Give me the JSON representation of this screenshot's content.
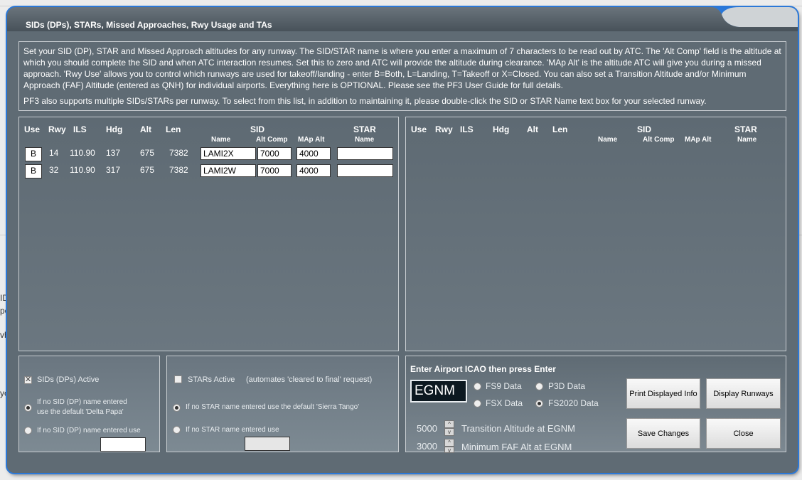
{
  "window": {
    "title": "SIDs (DPs), STARs, Missed Approaches, Rwy Usage and TAs"
  },
  "info": {
    "paragraph1": "Set your SID (DP), STAR and Missed Approach altitudes for any runway. The SID/STAR name is where you enter a maximum of 7 characters to be read out by ATC. The 'Alt Comp' field is the altitude at which you should complete the SID and when ATC interaction resumes. Set this to zero and ATC will provide the altitude during clearance. 'MAp Alt' is the altitude ATC will give you during a missed approach. 'Rwy Use' allows you to control which runways are used for takeoff/landing - enter B=Both, L=Landing, T=Takeoff or X=Closed.  You can also set a Transition Altitude and/or Minimum Approach (FAF) Altitude (entered as QNH) for individual airports. Everything here is OPTIONAL. Please see the PF3 User Guide for full details.",
    "paragraph2": "PF3 also supports multiple SIDs/STARs per runway. To select from this list, in addition to maintaining it, please double-click the SID or STAR Name text box for your selected runway."
  },
  "grid": {
    "headers": {
      "use": "Use",
      "rwy": "Rwy",
      "ils": "ILS",
      "hdg": "Hdg",
      "alt": "Alt",
      "len": "Len",
      "sid": "SID",
      "star": "STAR"
    },
    "subheaders": {
      "name": "Name",
      "alt_comp": "Alt Comp",
      "map_alt": "MAp Alt",
      "star_name": "Name"
    },
    "rows": [
      {
        "use": "B",
        "rwy": "14",
        "ils": "110.90",
        "hdg": "137",
        "alt": "675",
        "len": "7382",
        "sid_name": "LAMI2X",
        "alt_comp": "7000",
        "map_alt": "4000",
        "star_name": ""
      },
      {
        "use": "B",
        "rwy": "32",
        "ils": "110.90",
        "hdg": "317",
        "alt": "675",
        "len": "7382",
        "sid_name": "LAMI2W",
        "alt_comp": "7000",
        "map_alt": "4000",
        "star_name": ""
      }
    ]
  },
  "sid_options": {
    "active_label": "SIDs (DPs) Active",
    "active_checked": true,
    "default_label": "If no SID (DP) name entered use the default 'Delta Papa'",
    "default_line1": "If no SID (DP) name entered",
    "default_line2": "use the default 'Delta Papa'",
    "custom_label": "If no SID (DP) name entered use",
    "custom_value": ""
  },
  "star_options": {
    "active_label": "STARs Active",
    "active_note": "(automates 'cleared to final' request)",
    "active_checked": false,
    "default_label": "If no STAR name entered use the default 'Sierra Tango'",
    "custom_label": "If no STAR name entered use",
    "custom_value": ""
  },
  "icao": {
    "prompt": "Enter Airport ICAO then press Enter",
    "value": "EGNM",
    "data_sources": [
      "FS9 Data",
      "P3D Data",
      "FSX Data",
      "FS2020 Data"
    ],
    "selected_source": "FS2020 Data",
    "transition_alt": "5000",
    "transition_label": "Transition Altitude at EGNM",
    "faf_alt": "3000",
    "faf_label": "Minimum FAF Alt at EGNM"
  },
  "buttons": {
    "print": "Print Displayed Info",
    "display_runways": "Display Runways",
    "save": "Save Changes",
    "close": "Close"
  },
  "colors": {
    "window_bg": "#5f6b74",
    "accent": "#2b78d8",
    "text": "#ffffff"
  }
}
